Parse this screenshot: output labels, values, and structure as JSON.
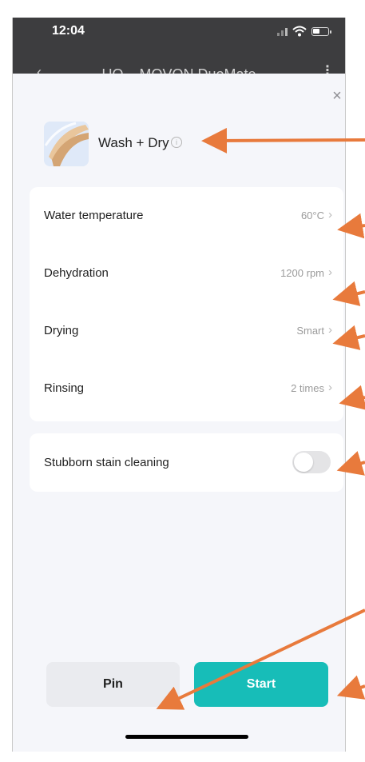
{
  "status_bar": {
    "time": "12:04"
  },
  "nav": {
    "title": "UQ – MOVON DuoMate",
    "back": "‹",
    "more": "⋮"
  },
  "sheet": {
    "close_glyph": "×",
    "program": {
      "name": "Wash + Dry",
      "info_glyph": "i",
      "thumb_icon": "program-thumbnail-icon"
    },
    "settings": [
      {
        "label": "Water temperature",
        "value": "60°C"
      },
      {
        "label": "Dehydration",
        "value": "1200 rpm"
      },
      {
        "label": "Drying",
        "value": "Smart"
      },
      {
        "label": "Rinsing",
        "value": "2 times"
      }
    ],
    "chevron": "›",
    "stain": {
      "label": "Stubborn stain cleaning",
      "enabled": false
    },
    "buttons": {
      "pin": "Pin",
      "start": "Start"
    }
  },
  "colors": {
    "accent": "#17bdb8",
    "annotation_arrow": "#e87a3c",
    "background": "#f5f6fa",
    "statusbar": "#3d3d3f"
  }
}
